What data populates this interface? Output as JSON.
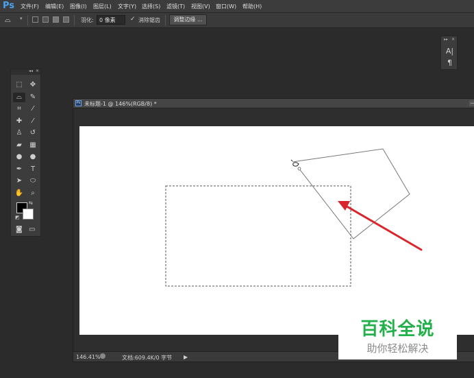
{
  "app": {
    "logo": "Ps"
  },
  "menu": [
    "文件(F)",
    "编辑(E)",
    "图像(I)",
    "图层(L)",
    "文字(Y)",
    "选择(S)",
    "滤镜(T)",
    "视图(V)",
    "窗口(W)",
    "帮助(H)"
  ],
  "options": {
    "feather_label": "羽化:",
    "feather_value": "0 像素",
    "antialias_label": "消除锯齿",
    "antialias_checked": true,
    "refine_edge_label": "调整边缘 ..."
  },
  "right_panel": {
    "icons": [
      "character-icon",
      "paragraph-icon"
    ],
    "glyphs": [
      "A|",
      "¶"
    ]
  },
  "tools": {
    "active": "polygonal-lasso-tool",
    "items": [
      {
        "name": "marquee-tool",
        "glyph": "⬚"
      },
      {
        "name": "move-tool",
        "glyph": "✥"
      },
      {
        "name": "polygonal-lasso-tool",
        "glyph": "⌓"
      },
      {
        "name": "quick-selection-tool",
        "glyph": "✎"
      },
      {
        "name": "crop-tool",
        "glyph": "⌗"
      },
      {
        "name": "eyedropper-tool",
        "glyph": "⁄"
      },
      {
        "name": "healing-brush-tool",
        "glyph": "✚"
      },
      {
        "name": "brush-tool",
        "glyph": "⁄"
      },
      {
        "name": "clone-stamp-tool",
        "glyph": "♙"
      },
      {
        "name": "history-brush-tool",
        "glyph": "↺"
      },
      {
        "name": "eraser-tool",
        "glyph": "▰"
      },
      {
        "name": "gradient-tool",
        "glyph": "▦"
      },
      {
        "name": "blur-tool",
        "glyph": "●"
      },
      {
        "name": "dodge-tool",
        "glyph": "●"
      },
      {
        "name": "pen-tool",
        "glyph": "✒"
      },
      {
        "name": "type-tool",
        "glyph": "T"
      },
      {
        "name": "path-selection-tool",
        "glyph": "➤"
      },
      {
        "name": "shape-tool",
        "glyph": "⬭"
      },
      {
        "name": "hand-tool",
        "glyph": "✋"
      },
      {
        "name": "zoom-tool",
        "glyph": "⌕"
      }
    ]
  },
  "document": {
    "tab_icon": "Ps",
    "title": "未标题-1 @ 146%(RGB/8) *",
    "zoom": "146.41%",
    "doc_info": "文档:609.4K/0 字节",
    "status_arrow": "▶"
  },
  "watermark": {
    "title": "百科全说",
    "subtitle": "助你轻松解决"
  },
  "colors": {
    "annotation_arrow": "#d9262c",
    "watermark_green": "#22b04a"
  }
}
